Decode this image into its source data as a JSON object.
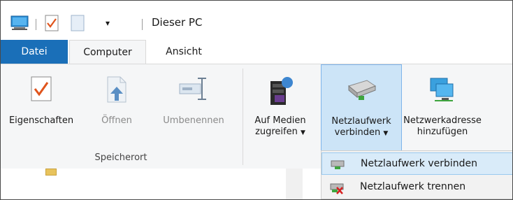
{
  "window": {
    "title": "Dieser PC"
  },
  "tabs": {
    "file": "Datei",
    "computer": "Computer",
    "view": "Ansicht"
  },
  "ribbon": {
    "location_group": {
      "label": "Speicherort",
      "properties": "Eigenschaften",
      "open": "Öffnen",
      "rename": "Umbenennen"
    },
    "network_group": {
      "media_line1": "Auf Medien",
      "media_line2": "zugreifen",
      "map_drive_line1": "Netzlaufwerk",
      "map_drive_line2": "verbinden",
      "add_location_line1": "Netzwerkadresse",
      "add_location_line2": "hinzufügen"
    }
  },
  "dropdown": {
    "items": [
      {
        "label": "Netzlaufwerk verbinden",
        "icon": "map-drive-icon"
      },
      {
        "label": "Netzlaufwerk trennen",
        "icon": "disconnect-drive-icon"
      }
    ]
  },
  "colors": {
    "file_tab": "#1a6fb8",
    "highlight": "#cce4f7"
  }
}
